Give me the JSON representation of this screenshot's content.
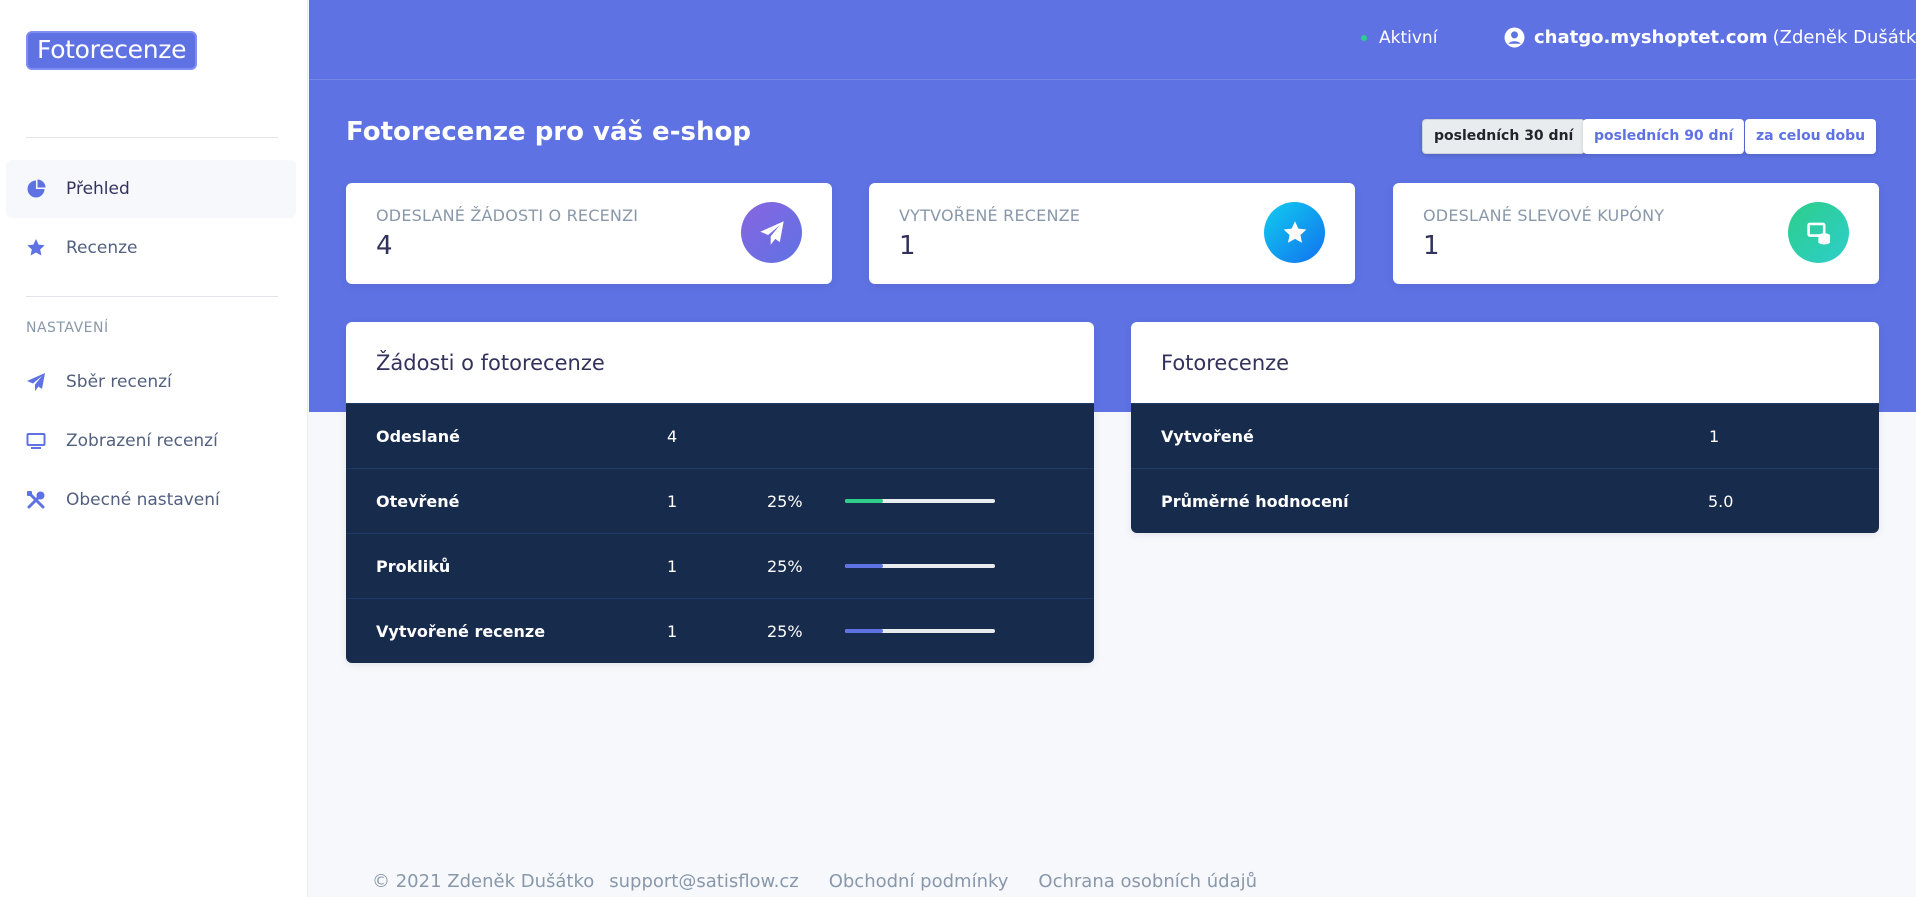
{
  "sidebar": {
    "brand": "Fotorecenze",
    "items": [
      {
        "label": "Přehled"
      },
      {
        "label": "Recenze"
      }
    ],
    "settings_heading": "NASTAVENÍ",
    "settings_items": [
      {
        "label": "Sběr recenzí"
      },
      {
        "label": "Zobrazení recenzí"
      },
      {
        "label": "Obecné nastavení"
      }
    ]
  },
  "topbar": {
    "status": "Aktivní",
    "shop": "chatgo.myshoptet.com",
    "owner": "(Zdeněk Dušátko)"
  },
  "header": {
    "title": "Fotorecenze pro váš e-shop",
    "ranges": [
      "posledních 30 dní",
      "posledních 90 dní",
      "za celou dobu"
    ],
    "selected_range": "posledních 30 dní"
  },
  "stats": [
    {
      "title": "Odeslané žádosti o recenzi",
      "value": "4",
      "icon": "paper-plane-icon",
      "color_from": "#8965e0",
      "color_to": "#5e72e4"
    },
    {
      "title": "Vytvořené recenze",
      "value": "1",
      "icon": "star-icon",
      "color_from": "#11cdef",
      "color_to": "#1171ef"
    },
    {
      "title": "Odeslané slevové kupóny",
      "value": "1",
      "icon": "coins-icon",
      "color_from": "#2dce89",
      "color_to": "#2dcecc"
    }
  ],
  "requests_panel": {
    "title": "Žádosti o fotorecenze",
    "rows": [
      {
        "label": "Odeslané",
        "count": "4"
      },
      {
        "label": "Otevřené",
        "count": "1",
        "percent_label": "25%",
        "progress": 0.25,
        "color": "#2dce89"
      },
      {
        "label": "Prokliků",
        "count": "1",
        "percent_label": "25%",
        "progress": 0.25,
        "color": "#5e72e4"
      },
      {
        "label": "Vytvořené recenze",
        "count": "1",
        "percent_label": "25%",
        "progress": 0.25,
        "color": "#5e72e4"
      }
    ]
  },
  "reviews_panel": {
    "title": "Fotorecenze",
    "rows": [
      {
        "label": "Vytvořené",
        "value": "1"
      },
      {
        "label": "Průměrné hodnocení",
        "value": "5.0"
      }
    ]
  },
  "footer": {
    "copyright": "© 2021 Zdeněk Dušátko",
    "support": "support@satisflow.cz",
    "terms": "Obchodní podmínky",
    "privacy": "Ochrana osobních údajů"
  }
}
